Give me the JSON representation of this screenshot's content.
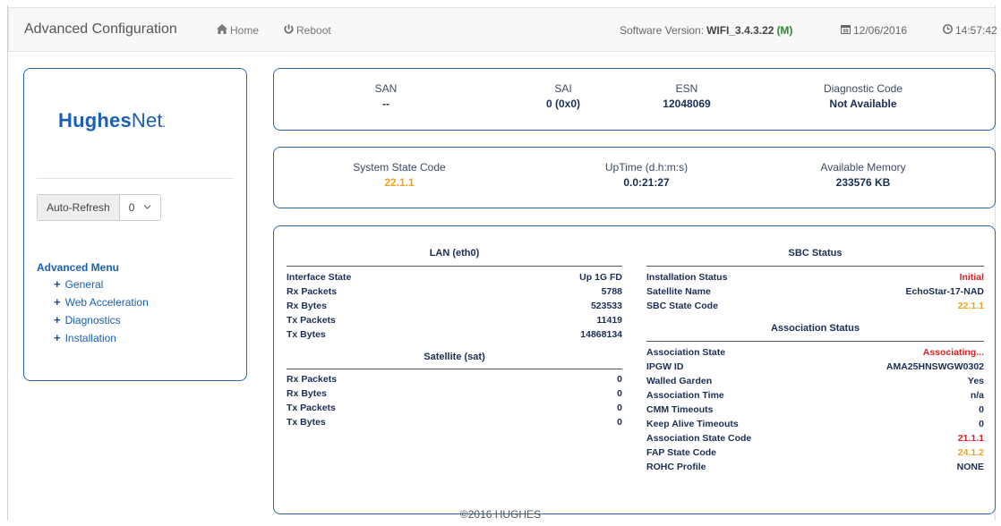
{
  "header": {
    "title": "Advanced Configuration",
    "home_label": "Home",
    "reboot_label": "Reboot",
    "software_version_label": "Software Version:",
    "software_version_value": "WIFI_3.4.3.22",
    "software_version_suffix": "(M)",
    "date": "12/06/2016",
    "time": "14:57:42"
  },
  "sidebar": {
    "logo_bold": "Hughes",
    "logo_light": "Net",
    "auto_refresh_label": "Auto-Refresh",
    "auto_refresh_value": "0",
    "menu_title": "Advanced Menu",
    "menu_items": [
      {
        "label": "General"
      },
      {
        "label": "Web Acceleration"
      },
      {
        "label": "Diagnostics"
      },
      {
        "label": "Installation"
      }
    ]
  },
  "summary": {
    "san_label": "SAN",
    "san_value": "--",
    "sai_label": "SAI",
    "sai_value": "0 (0x0)",
    "esn_label": "ESN",
    "esn_value": "12048069",
    "diag_label": "Diagnostic Code",
    "diag_value": "Not Available"
  },
  "system": {
    "state_label": "System State Code",
    "state_value": "22.1.1",
    "uptime_label": "UpTime (d.h:m:s)",
    "uptime_value": "0.0:21:27",
    "memory_label": "Available Memory",
    "memory_value": "233576 KB"
  },
  "lan": {
    "title": "LAN (eth0)",
    "rows": [
      {
        "k": "Interface State",
        "v": "Up 1G FD"
      },
      {
        "k": "Rx Packets",
        "v": "5788"
      },
      {
        "k": "Rx Bytes",
        "v": "523533"
      },
      {
        "k": "Tx Packets",
        "v": "11419"
      },
      {
        "k": "Tx Bytes",
        "v": "14868134"
      }
    ]
  },
  "satellite": {
    "title": "Satellite (sat)",
    "rows": [
      {
        "k": "Rx Packets",
        "v": "0"
      },
      {
        "k": "Rx Bytes",
        "v": "0"
      },
      {
        "k": "Tx Packets",
        "v": "0"
      },
      {
        "k": "Tx Bytes",
        "v": "0"
      }
    ]
  },
  "sbc": {
    "title": "SBC Status",
    "rows": [
      {
        "k": "Installation Status",
        "v": "Initial"
      },
      {
        "k": "Satellite Name",
        "v": "EchoStar-17-NAD"
      },
      {
        "k": "SBC State Code",
        "v": "22.1.1"
      }
    ]
  },
  "association": {
    "title": "Association Status",
    "rows": [
      {
        "k": "Association State",
        "v": "Associating..."
      },
      {
        "k": "IPGW ID",
        "v": "AMA25HNSWGW0302"
      },
      {
        "k": "Walled Garden",
        "v": "Yes"
      },
      {
        "k": "Association Time",
        "v": "n/a"
      },
      {
        "k": "CMM Timeouts",
        "v": "0"
      },
      {
        "k": "Keep Alive Timeouts",
        "v": "0"
      },
      {
        "k": "Association State Code",
        "v": "21.1.1"
      },
      {
        "k": "FAP State Code",
        "v": "24.1.2"
      },
      {
        "k": "ROHC Profile",
        "v": "NONE"
      }
    ]
  },
  "colors": {
    "accent": "#1a5fb4",
    "panel_border": "#2b68a8",
    "warning": "#f0a020",
    "error": "#e02020"
  },
  "footer": {
    "copyright": "©2016 HUGHES"
  }
}
